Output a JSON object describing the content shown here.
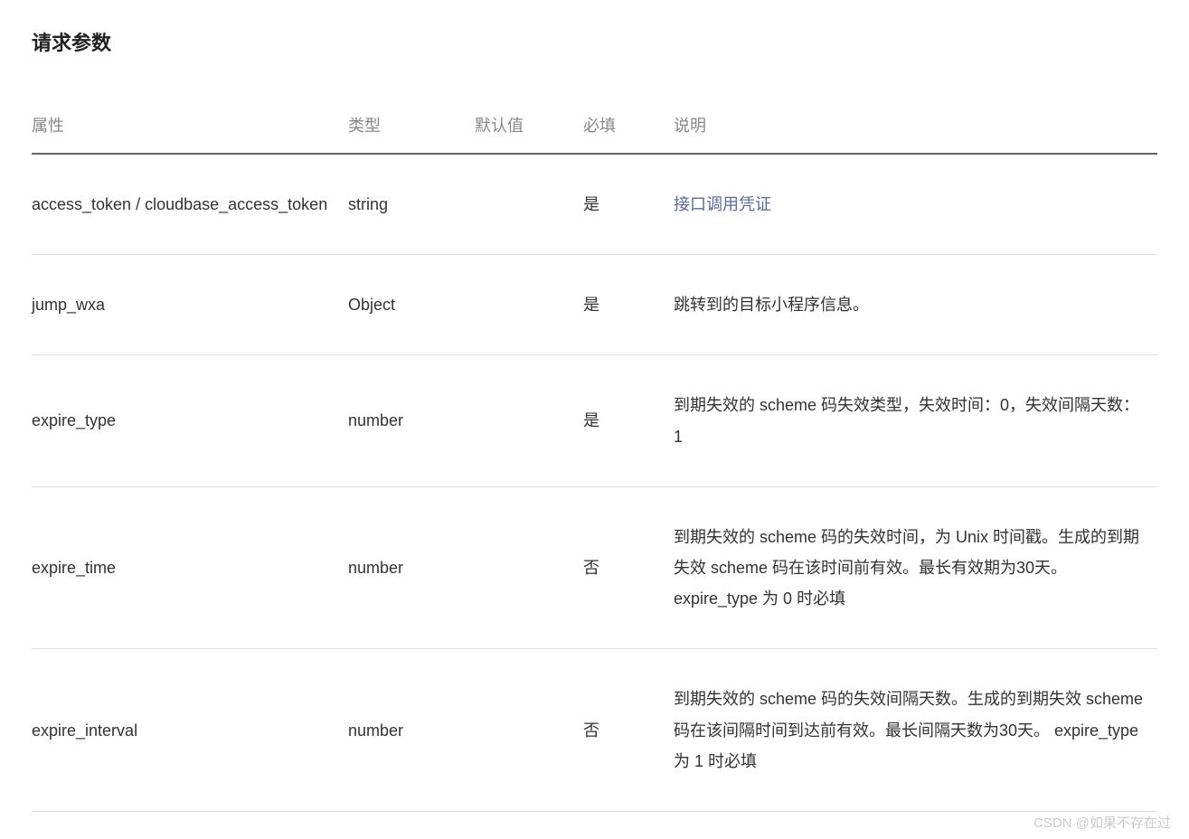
{
  "section_title": "请求参数",
  "headers": {
    "attr": "属性",
    "type": "类型",
    "default": "默认值",
    "required": "必填",
    "desc": "说明"
  },
  "rows": [
    {
      "attr": "access_token / cloudbase_access_token",
      "type": "string",
      "default": "",
      "required": "是",
      "desc": "接口调用凭证",
      "desc_is_link": true
    },
    {
      "attr": "jump_wxa",
      "type": "Object",
      "default": "",
      "required": "是",
      "desc": "跳转到的目标小程序信息。",
      "desc_is_link": false
    },
    {
      "attr": "expire_type",
      "type": "number",
      "default": "",
      "required": "是",
      "desc": "到期失效的 scheme 码失效类型，失效时间：0，失效间隔天数：1",
      "desc_is_link": false
    },
    {
      "attr": "expire_time",
      "type": "number",
      "default": "",
      "required": "否",
      "desc": "到期失效的 scheme 码的失效时间，为 Unix 时间戳。生成的到期失效 scheme 码在该时间前有效。最长有效期为30天。expire_type 为 0 时必填",
      "desc_is_link": false
    },
    {
      "attr": "expire_interval",
      "type": "number",
      "default": "",
      "required": "否",
      "desc": "到期失效的 scheme 码的失效间隔天数。生成的到期失效 scheme 码在该间隔时间到达前有效。最长间隔天数为30天。 expire_type 为 1 时必填",
      "desc_is_link": false
    }
  ],
  "watermark": "CSDN @如果不存在过"
}
